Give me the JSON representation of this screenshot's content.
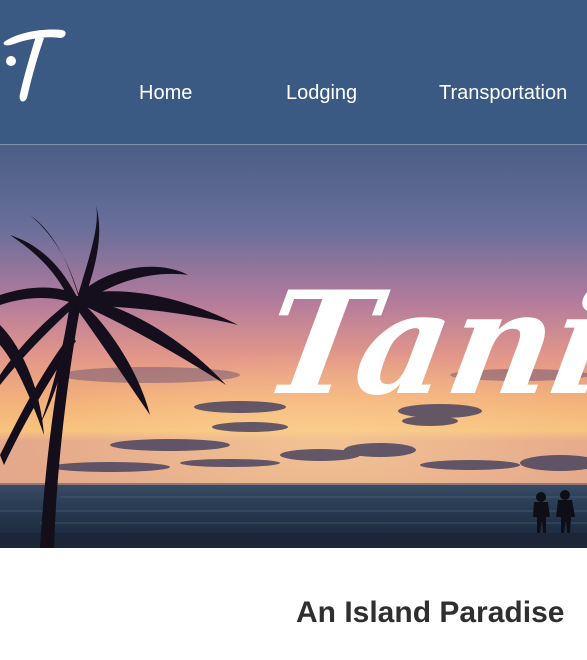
{
  "header": {
    "logo_alt": "T",
    "nav": [
      {
        "label": "Home"
      },
      {
        "label": "Lodging"
      },
      {
        "label": "Transportation"
      }
    ]
  },
  "hero": {
    "title": "Tani",
    "scene": "sunset-beach-with-palm-trees"
  },
  "main": {
    "heading": "An Island Paradise"
  },
  "colors": {
    "header_bg": "#3a5a84",
    "nav_text": "#ffffff",
    "heading_text": "#2f2f2f",
    "page_bg": "#ffffff"
  }
}
